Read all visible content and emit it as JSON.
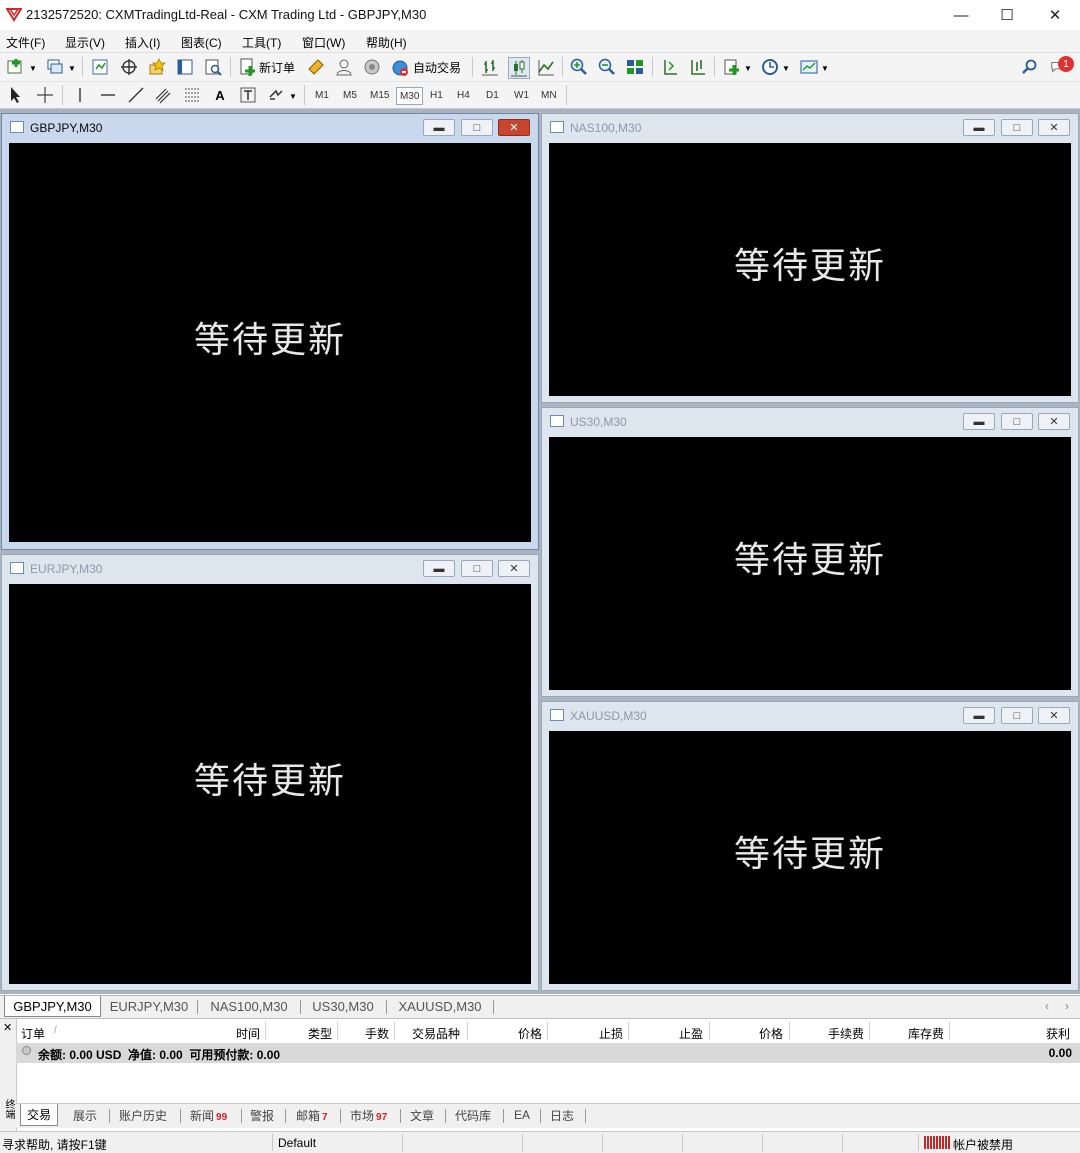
{
  "window": {
    "title": "2132572520: CXMTradingLtd-Real - CXM Trading Ltd - GBPJPY,M30",
    "minimize_glyph": "—",
    "maximize_glyph": "☐",
    "close_glyph": "✕"
  },
  "menu": [
    "文件(F)",
    "显示(V)",
    "插入(I)",
    "图表(C)",
    "工具(T)",
    "窗口(W)",
    "帮助(H)"
  ],
  "toolbar": {
    "new_order_label": "新订单",
    "auto_trading_label": "自动交易",
    "notification_count": "1",
    "text_tool_label": "A",
    "timeframes": [
      "M1",
      "M5",
      "M15",
      "M30",
      "H1",
      "H4",
      "D1",
      "W1",
      "MN"
    ],
    "active_timeframe": "M30"
  },
  "charts": [
    {
      "title": "GBPJPY,M30",
      "status": "等待更新",
      "active": true
    },
    {
      "title": "EURJPY,M30",
      "status": "等待更新",
      "active": false
    },
    {
      "title": "NAS100,M30",
      "status": "等待更新",
      "active": false
    },
    {
      "title": "US30,M30",
      "status": "等待更新",
      "active": false
    },
    {
      "title": "XAUUSD,M30",
      "status": "等待更新",
      "active": false
    }
  ],
  "chart_tabs": [
    "GBPJPY,M30",
    "EURJPY,M30",
    "NAS100,M30",
    "US30,M30",
    "XAUUSD,M30"
  ],
  "chart_tabs_scroll": [
    "‹",
    "›"
  ],
  "terminal": {
    "columns": [
      "订单",
      "/",
      "时间",
      "类型",
      "手数",
      "交易品种",
      "价格",
      "止损",
      "止盈",
      "价格",
      "手续费",
      "库存费",
      "获利"
    ],
    "balance_text": "余额: 0.00 USD  净值: 0.00  可用预付款: 0.00",
    "balance_profit": "0.00",
    "side_label": "终端",
    "close_glyph": "✕",
    "tabs": [
      {
        "label": "交易"
      },
      {
        "label": "展示"
      },
      {
        "label": "账户历史"
      },
      {
        "label": "新闻",
        "badge": "99"
      },
      {
        "label": "警报"
      },
      {
        "label": "邮箱",
        "badge": "7"
      },
      {
        "label": "市场",
        "badge": "97"
      },
      {
        "label": "文章"
      },
      {
        "label": "代码库"
      },
      {
        "label": "EA"
      },
      {
        "label": "日志"
      }
    ]
  },
  "statusbar": {
    "help": "寻求帮助, 请按F1键",
    "profile": "Default",
    "account_status": "帐户被禁用"
  },
  "colors": {
    "chart_background": "#000000",
    "waiting_text": "#e8e8e8",
    "active_close_button": "#c8462f",
    "badge_red": "#d62020",
    "notification_red": "#e03030"
  }
}
